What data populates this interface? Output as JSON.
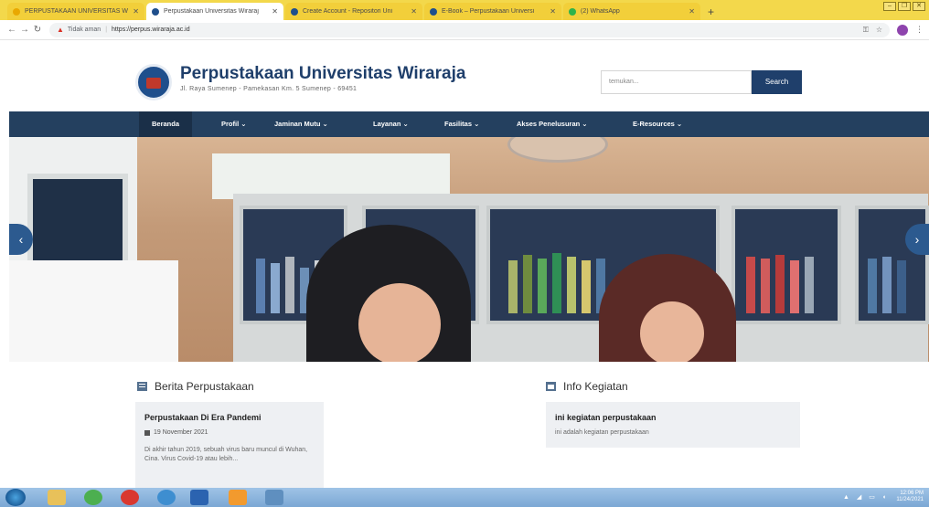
{
  "browser": {
    "tabs": [
      {
        "title": "PERPUSTAKAAN UNIVERSITAS W",
        "icon": "library-favicon",
        "active": false
      },
      {
        "title": "Perpustakaan Universitas Wiraraj",
        "icon": "university-favicon",
        "active": true
      },
      {
        "title": "Create Account - Repositori Uni",
        "icon": "university-favicon",
        "active": false
      },
      {
        "title": "E-Book – Perpustakaan Universi",
        "icon": "university-favicon",
        "active": false
      },
      {
        "title": "(2) WhatsApp",
        "icon": "whatsapp-favicon",
        "active": false
      }
    ],
    "new_tab_label": "+",
    "window_controls": [
      "–",
      "❐",
      "✕"
    ],
    "address": {
      "security_label": "Tidak aman",
      "url": "https://perpus.wiraraja.ac.id"
    }
  },
  "site": {
    "title": "Perpustakaan Universitas Wiraraja",
    "address": "Jl. Raya Sumenep - Pamekasan Km. 5 Sumenep - 69451",
    "search_placeholder": "temukan...",
    "search_button": "Search"
  },
  "nav": [
    {
      "label": "Beranda",
      "active": true
    },
    {
      "label": "Profil ⌄"
    },
    {
      "label": "Jaminan Mutu ⌄"
    },
    {
      "label": "Layanan ⌄"
    },
    {
      "label": "Fasilitas ⌄"
    },
    {
      "label": "Akses Penelusuran ⌄"
    },
    {
      "label": "E-Resources ⌄"
    }
  ],
  "hero": {
    "prev_label": "‹",
    "next_label": "›"
  },
  "news": {
    "heading": "Berita Perpustakaan",
    "item": {
      "title": "Perpustakaan Di Era Pandemi",
      "date": "19 November 2021",
      "excerpt": "Di akhir tahun 2019, sebuah virus baru muncul di Wuhan, Cina. Virus Covid-19 atau lebih..."
    }
  },
  "events": {
    "heading": "Info Kegiatan",
    "item": {
      "title": "ini kegiatan perpustakaan",
      "excerpt": "ini adalah kegiatan perpustakaan"
    }
  },
  "taskbar": {
    "time": "12:06 PM",
    "date": "11/24/2021",
    "tray": "▲ ◢ ▭ ◖"
  }
}
